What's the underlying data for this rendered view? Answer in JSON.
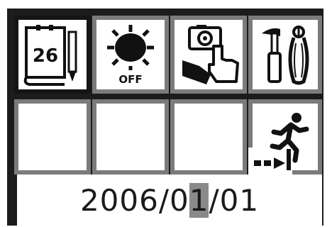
{
  "menu": {
    "items": [
      {
        "id": "date-setting",
        "icon": "calendar-pen-icon",
        "calendar_day": "26",
        "selected": true
      },
      {
        "id": "power-saving",
        "icon": "sun-off-icon",
        "badge": "OFF",
        "selected": false
      },
      {
        "id": "camera-operation",
        "icon": "hand-camera-icon",
        "selected": false
      },
      {
        "id": "tools",
        "icon": "tools-icon",
        "selected": false
      },
      {
        "id": "empty-1",
        "icon": "",
        "selected": false
      },
      {
        "id": "empty-2",
        "icon": "",
        "selected": false
      },
      {
        "id": "empty-3",
        "icon": "",
        "selected": false
      },
      {
        "id": "exit",
        "icon": "exit-running-man-icon",
        "selected": false
      }
    ]
  },
  "date": {
    "year": "2006",
    "sep1": "/",
    "month_tens": "0",
    "month_ones": "1",
    "sep2": "/",
    "day": "01",
    "cursor_position": "month_ones"
  },
  "colors": {
    "cell_border": "#7b7b7b",
    "selected_border": "#151515",
    "frame": "#1c1c1c",
    "cursor": "#8a8a8a"
  }
}
